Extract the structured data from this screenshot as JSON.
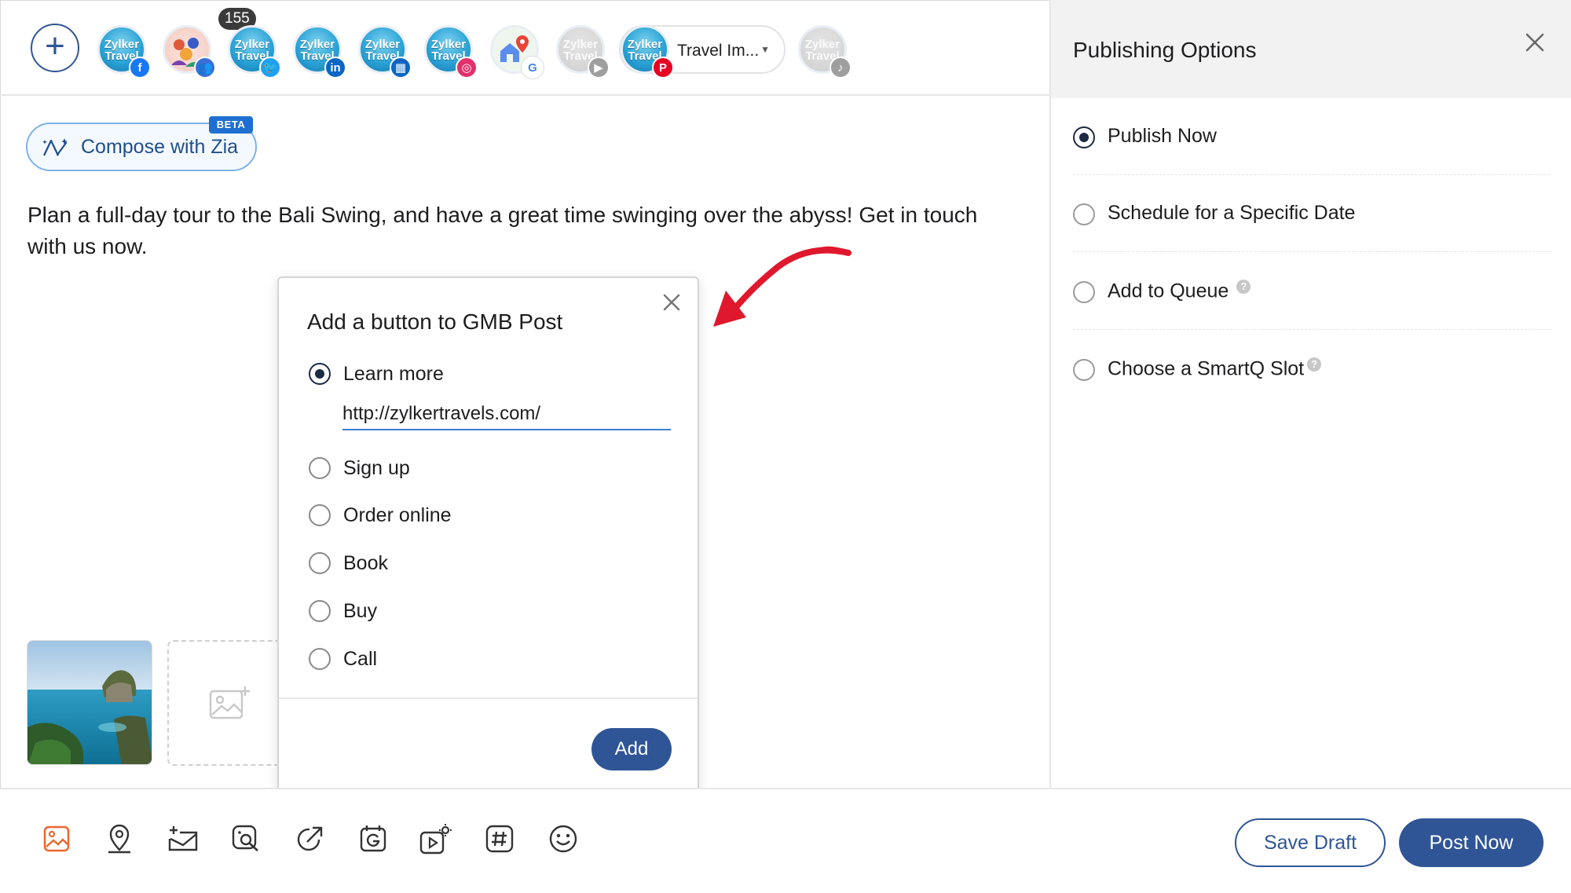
{
  "profiles": {
    "add_label": "+",
    "avatars": [
      {
        "name": "Zylker Travels",
        "brand_line1": "Zylker",
        "brand_line2": "Travel",
        "network": "facebook",
        "network_color": "#1877f2",
        "network_glyph": "f"
      },
      {
        "name": "Community group",
        "brand_line1": "",
        "brand_line2": "",
        "network": "facebook-group",
        "network_color": "#3b6fd6",
        "network_glyph": "👥"
      },
      {
        "name": "Zylker Travels",
        "brand_line1": "Zylker",
        "brand_line2": "Travel",
        "network": "twitter",
        "network_color": "#1da1f2",
        "network_glyph": "🐦"
      },
      {
        "name": "Zylker Travels",
        "brand_line1": "Zylker",
        "brand_line2": "Travel",
        "network": "linkedin",
        "network_color": "#0a66c2",
        "network_glyph": "in"
      },
      {
        "name": "Zylker Travels",
        "brand_line1": "Zylker",
        "brand_line2": "Travel",
        "network": "linkedin-page",
        "network_color": "#0a66c2",
        "network_glyph": "▦"
      },
      {
        "name": "Zylker Travels",
        "brand_line1": "Zylker",
        "brand_line2": "Travel",
        "network": "instagram",
        "network_color": "#e1306c",
        "network_glyph": "◎"
      },
      {
        "name": "Google My Business",
        "brand_line1": "",
        "brand_line2": "",
        "network": "google",
        "network_color": "#4285f4",
        "network_glyph": "G"
      },
      {
        "name": "Zylker Travels",
        "brand_line1": "Zylker",
        "brand_line2": "Travel",
        "network": "youtube",
        "network_color": "#9e9e9e",
        "network_glyph": "▶"
      },
      {
        "name": "Zylker Travels",
        "brand_line1": "Zylker",
        "brand_line2": "Travel",
        "network": "pinterest",
        "network_color": "#e60023",
        "network_glyph": "P"
      },
      {
        "name": "Zylker Travels",
        "brand_line1": "Zylker",
        "brand_line2": "Travel",
        "network": "tiktok",
        "network_color": "#9e9e9e",
        "network_glyph": "♪"
      }
    ],
    "notification_count": "155",
    "pinterest_board": "Travel Im..."
  },
  "composer": {
    "zia_label": "Compose with Zia",
    "beta_label": "BETA",
    "post_text": "Plan a full-day tour to the Bali Swing, and have a great time swinging over the abyss! Get in touch with us now."
  },
  "gmb_popup": {
    "title": "Add a button to GMB Post",
    "options": [
      "Learn more",
      "Sign up",
      "Order online",
      "Book",
      "Buy",
      "Call"
    ],
    "selected": "Learn more",
    "url_value": "http://zylkertravels.com/",
    "add_label": "Add"
  },
  "publishing": {
    "title": "Publishing Options",
    "options": [
      {
        "label": "Publish Now",
        "selected": true,
        "help": false
      },
      {
        "label": "Schedule for a Specific Date",
        "selected": false,
        "help": false
      },
      {
        "label": "Add to Queue",
        "selected": false,
        "help": true
      },
      {
        "label": "Choose a SmartQ Slot",
        "selected": false,
        "help": true
      }
    ],
    "help_glyph": "?"
  },
  "toolbar": {
    "tools": [
      "image-icon",
      "location-icon",
      "newsletter-icon",
      "photo-search-icon",
      "share-link-icon",
      "gmb-event-icon",
      "video-settings-icon",
      "hashtag-icon",
      "emoji-icon"
    ],
    "save_draft_label": "Save Draft",
    "post_now_label": "Post Now"
  },
  "colors": {
    "primary": "#2f5597",
    "accent_arrow": "#e0182d",
    "input_underline": "#3d7ed8"
  }
}
